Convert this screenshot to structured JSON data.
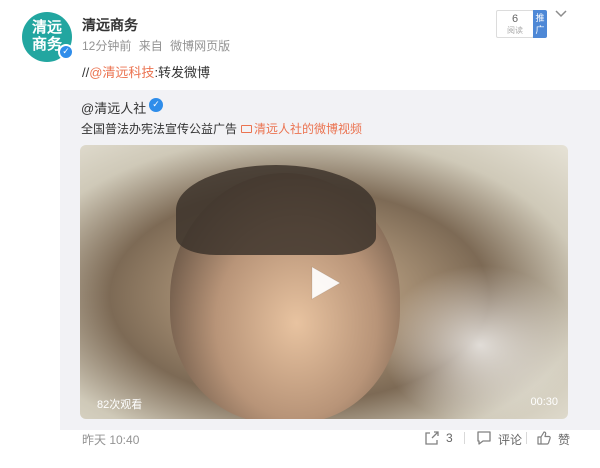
{
  "post": {
    "avatar_text": [
      "清远",
      "商务"
    ],
    "username": "清远商务",
    "time_ago": "12分钟前",
    "source_prefix": "来自",
    "source": "微博网页版",
    "read_count": "6",
    "read_label": "阅读",
    "promote_label": "推广",
    "repost_slashes": "//",
    "mention": "@清远科技",
    "repost_suffix": ":转发微博",
    "footer_time": "昨天 10:40",
    "repost_count": "3",
    "comment_label": "评论",
    "like_label": "赞"
  },
  "retweet": {
    "user": "@清远人社",
    "text": "全国普法办宪法宣传公益广告",
    "video_link": "清远人社的微博视频",
    "video_views": "82次观看",
    "video_duration": "00:30"
  },
  "icons": {
    "verify": "verified-badge-icon",
    "more": "chevron-down-icon",
    "play": "play-icon",
    "video": "video-icon",
    "repost": "repost-icon",
    "comment": "comment-icon",
    "like": "thumbs-up-icon"
  },
  "colors": {
    "accent": "#eb7350",
    "verify": "#2f8dea",
    "avatar": "#22a6a0",
    "promote": "#4e88d6"
  }
}
